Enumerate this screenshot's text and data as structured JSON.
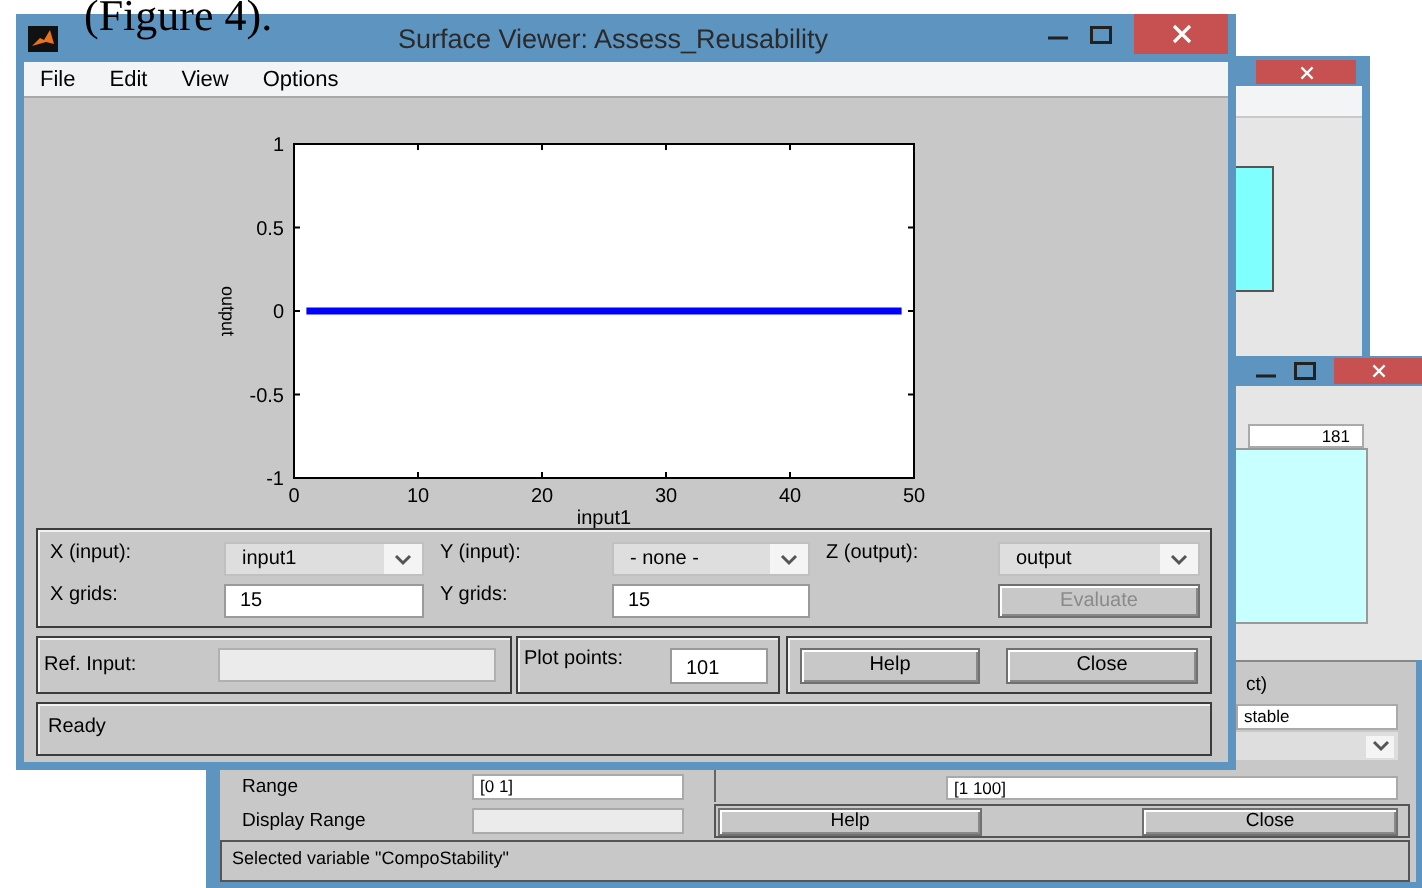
{
  "caption": "(Figure 4).",
  "surface_viewer": {
    "title": "Surface Viewer: Assess_Reusability",
    "menu": [
      "File",
      "Edit",
      "View",
      "Options"
    ],
    "chart_data": {
      "type": "line",
      "xlabel": "input1",
      "ylabel": "output",
      "x": [
        1,
        49
      ],
      "series": [
        {
          "color": "#0000ff",
          "values": [
            0,
            0
          ]
        }
      ],
      "xlim": [
        0,
        50
      ],
      "ylim": [
        -1,
        1
      ],
      "xticks": [
        0,
        10,
        20,
        30,
        40,
        50
      ],
      "yticks": [
        -1,
        -0.5,
        0,
        0.5,
        1
      ]
    },
    "x_input": {
      "label": "X (input):",
      "value": "input1"
    },
    "y_input": {
      "label": "Y (input):",
      "value": "- none -"
    },
    "z_output": {
      "label": "Z (output):",
      "value": "output"
    },
    "x_grids": {
      "label": "X grids:",
      "value": "15"
    },
    "y_grids": {
      "label": "Y grids:",
      "value": "15"
    },
    "evaluate": {
      "label": "Evaluate",
      "disabled": true
    },
    "ref_input": {
      "label": "Ref. Input:"
    },
    "plot_points": {
      "label": "Plot points:",
      "value": "101"
    },
    "buttons": [
      "Help",
      "Close"
    ],
    "status": "Ready"
  },
  "back_window": {
    "count_value": "181",
    "label_fragment": "ct)",
    "name_fragment": "stable",
    "params_value": "[1 100]",
    "range": {
      "label": "Range",
      "value": "[0 1]"
    },
    "display_range": {
      "label": "Display Range"
    },
    "buttons": [
      "Help",
      "Close"
    ],
    "status": "Selected variable \"CompoStability\""
  }
}
